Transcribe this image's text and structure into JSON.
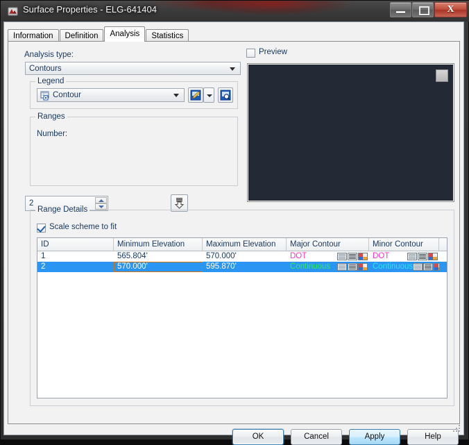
{
  "window": {
    "title": "Surface Properties - ELG-641404",
    "icon": "autocad-surface-icon",
    "minimize_label": "–",
    "maximize_label": "□",
    "close_label": "X"
  },
  "tabs": [
    {
      "label": "Information",
      "active": false
    },
    {
      "label": "Definition",
      "active": false
    },
    {
      "label": "Analysis",
      "active": true
    },
    {
      "label": "Statistics",
      "active": false
    }
  ],
  "analysis": {
    "type_label": "Analysis type:",
    "type_value": "Contours"
  },
  "legend": {
    "group_title": "Legend",
    "value": "Contour",
    "icon": "legend-table-icon",
    "edit_button_icon": "edit-pencil-icon",
    "edit_dropdown_icon": "chevron-down-icon",
    "zoom_button_icon": "zoom-preview-icon"
  },
  "ranges": {
    "group_title": "Ranges",
    "number_label": "Number:",
    "number_value": "2",
    "spin_up_icon": "spinner-up-icon",
    "spin_down_icon": "spinner-down-icon",
    "action_button_icon": "apply-down-arrow-icon"
  },
  "preview": {
    "checkbox_label": "Preview",
    "checked": false,
    "canvas_color": "#232a36",
    "corner_icon": "preview-corner-square"
  },
  "range_details": {
    "group_title": "Range Details",
    "scale_checkbox_label": "Scale scheme to fit",
    "scale_checked": true,
    "columns": [
      "ID",
      "Minimum Elevation",
      "Maximum Elevation",
      "Major Contour",
      "Minor Contour"
    ],
    "rows": [
      {
        "id": "1",
        "min_elevation": "565.804'",
        "max_elevation": "570.000'",
        "major_contour": "DOT",
        "major_color": "#ff2fd0",
        "minor_contour": "DOT",
        "minor_color": "#ff2fd0",
        "selected": false,
        "focused_cell": null
      },
      {
        "id": "2",
        "min_elevation": "570.000'",
        "max_elevation": "595.870'",
        "major_contour": "Continuous",
        "major_color": "#2bf05a",
        "minor_contour": "Continuous",
        "minor_color": "#33e3ff",
        "selected": true,
        "focused_cell": "min_elevation"
      }
    ],
    "selection_color": "#2a95f2",
    "focus_border_color": "#d8750a"
  },
  "buttons": {
    "ok": "OK",
    "cancel": "Cancel",
    "apply": "Apply",
    "help": "Help"
  }
}
